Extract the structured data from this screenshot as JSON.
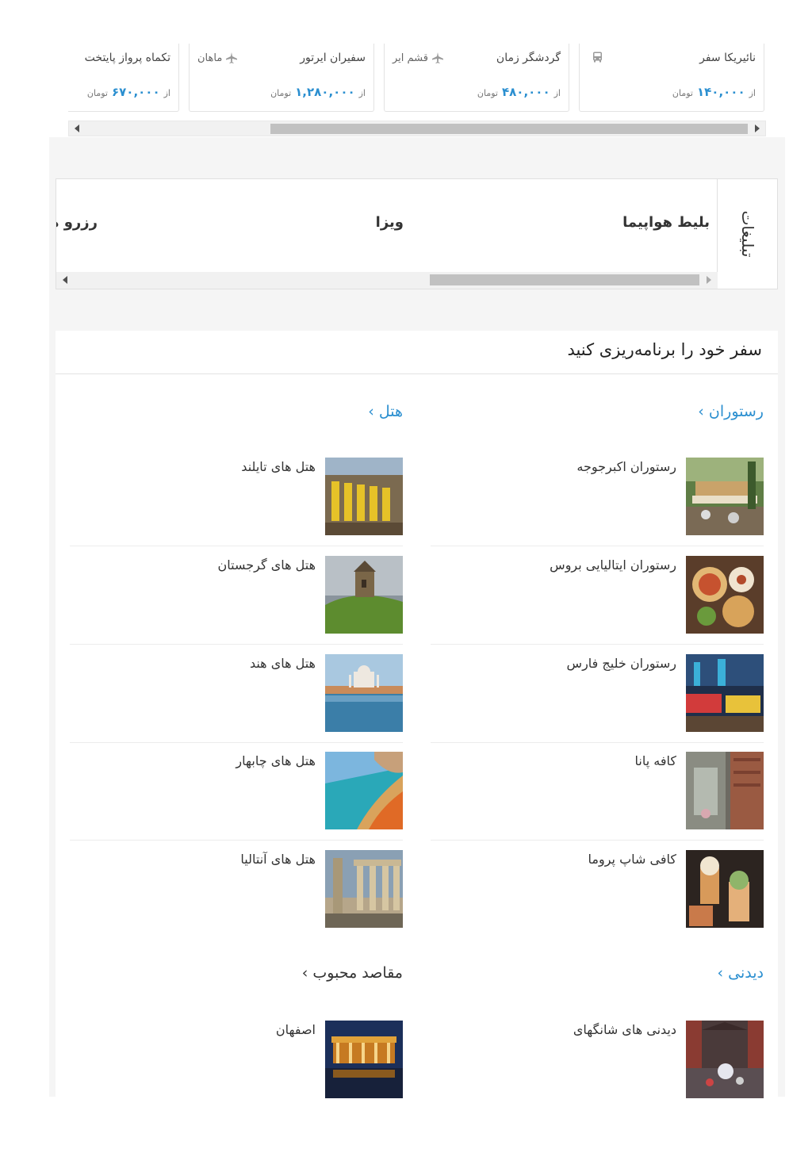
{
  "deals": [
    {
      "company": "نائیریکا سفر",
      "airline": "",
      "transport_icon": "bus-icon",
      "from_label": "از",
      "price": "۱۴۰,۰۰۰",
      "currency": "تومان"
    },
    {
      "company": "گردشگر زمان",
      "airline": "قشم ایر",
      "transport_icon": "plane-icon",
      "from_label": "از",
      "price": "۴۸۰,۰۰۰",
      "currency": "تومان"
    },
    {
      "company": "سفیران ایرتور",
      "airline": "ماهان",
      "transport_icon": "plane-icon",
      "from_label": "از",
      "price": "۱,۲۸۰,۰۰۰",
      "currency": "تومان"
    },
    {
      "company": "تکماه پرواز پایتخت",
      "airline": "",
      "transport_icon": "plane-icon",
      "from_label": "از",
      "price": "۶۷۰,۰۰۰",
      "currency": "تومان"
    }
  ],
  "ads": {
    "side_title": "تبلیغات",
    "links": [
      "بلیط هواپیما",
      "ویزا",
      "رزرو هتل"
    ]
  },
  "plan": {
    "title": "سفر خود را برنامه‌ریزی کنید",
    "sections": [
      {
        "heading": "رستوران ›",
        "items": [
          {
            "label": "رستوران اکبرجوجه"
          },
          {
            "label": "رستوران ایتالیایی بروس"
          },
          {
            "label": "رستوران خلیج فارس"
          },
          {
            "label": "کافه پانا"
          },
          {
            "label": "کافی شاپ پروما"
          }
        ]
      },
      {
        "heading": "هتل ›",
        "items": [
          {
            "label": "هتل های تایلند"
          },
          {
            "label": "هتل های گرجستان"
          },
          {
            "label": "هتل های هند"
          },
          {
            "label": "هتل های چابهار"
          },
          {
            "label": "هتل های آنتالیا"
          }
        ]
      },
      {
        "heading": "دیدنی ›",
        "items": [
          {
            "label": "دیدنی های شانگهای"
          }
        ]
      },
      {
        "heading": "مقاصد محبوب ›",
        "items": [
          {
            "label": "اصفهان"
          }
        ]
      }
    ]
  },
  "colors": {
    "link": "#2b8fd0",
    "band": "#f5f5f5",
    "scroll_thumb": "#c1c1c1"
  }
}
